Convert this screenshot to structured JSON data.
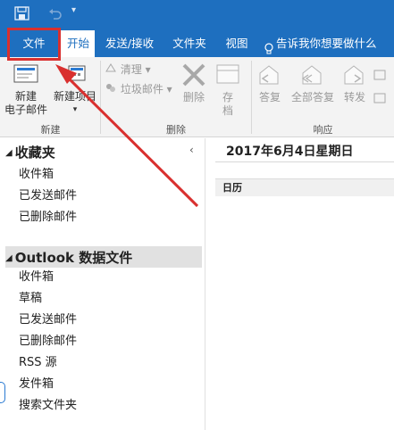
{
  "quick_access": {
    "save_icon": "save-icon",
    "undo_icon": "undo-icon",
    "more": "▾"
  },
  "tabs": {
    "file": "文件",
    "home": "开始",
    "send_receive": "发送/接收",
    "folder": "文件夹",
    "view": "视图",
    "tell_me": "告诉我你想要做什么"
  },
  "ribbon": {
    "new_group": {
      "new_email_line1": "新建",
      "new_email_line2": "电子邮件",
      "new_items_line1": "新建项目",
      "new_items_caret": "▾",
      "label": "新建"
    },
    "delete_group": {
      "cleanup": "清理",
      "junk": "垃圾邮件",
      "delete": "删除",
      "archive_line1": "存",
      "archive_line2": "档",
      "label": "删除"
    },
    "respond_group": {
      "reply": "答复",
      "reply_all": "全部答复",
      "forward": "转发",
      "label": "响应"
    }
  },
  "nav": {
    "favorites": {
      "header": "收藏夹",
      "items": [
        "收件箱",
        "已发送邮件",
        "已删除邮件"
      ]
    },
    "data_file": {
      "header": "Outlook 数据文件",
      "items": [
        "收件箱",
        "草稿",
        "已发送邮件",
        "已删除邮件",
        "RSS 源",
        "发件箱",
        "搜索文件夹"
      ]
    },
    "collapse": "‹"
  },
  "main": {
    "date_title": "2017年6月4日星期日",
    "calendar_label": "日历"
  },
  "colors": {
    "accent": "#1e6fbf",
    "highlight": "#d9302f"
  }
}
